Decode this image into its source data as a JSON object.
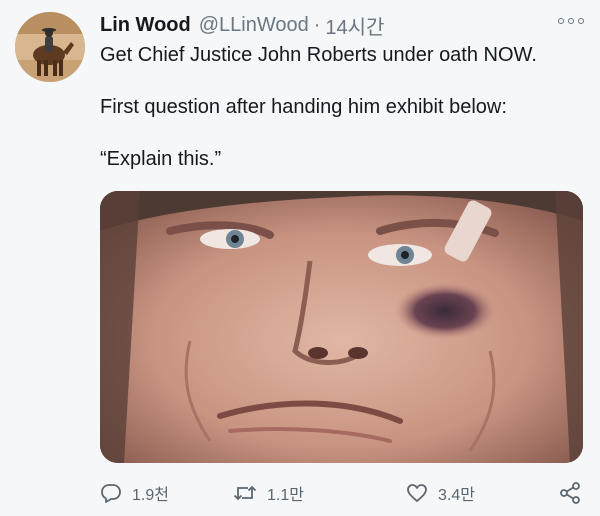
{
  "tweet": {
    "author": {
      "display_name": "Lin Wood",
      "handle": "@LLinWood",
      "separator": "·",
      "time": "14시간"
    },
    "text_lines": [
      "Get Chief Justice John Roberts under oath NOW.",
      "First question after handing him exhibit below:",
      "“Explain this.”"
    ],
    "media": {
      "description_icon": "photo-close-up-face"
    },
    "actions": {
      "reply_count": "1.9천",
      "retweet_count": "1.1만",
      "like_count": "3.4만"
    }
  },
  "colors": {
    "background": "#f5f7f9",
    "text_primary": "#141a1f",
    "text_secondary": "#6a7681",
    "icon": "#5b6770"
  }
}
